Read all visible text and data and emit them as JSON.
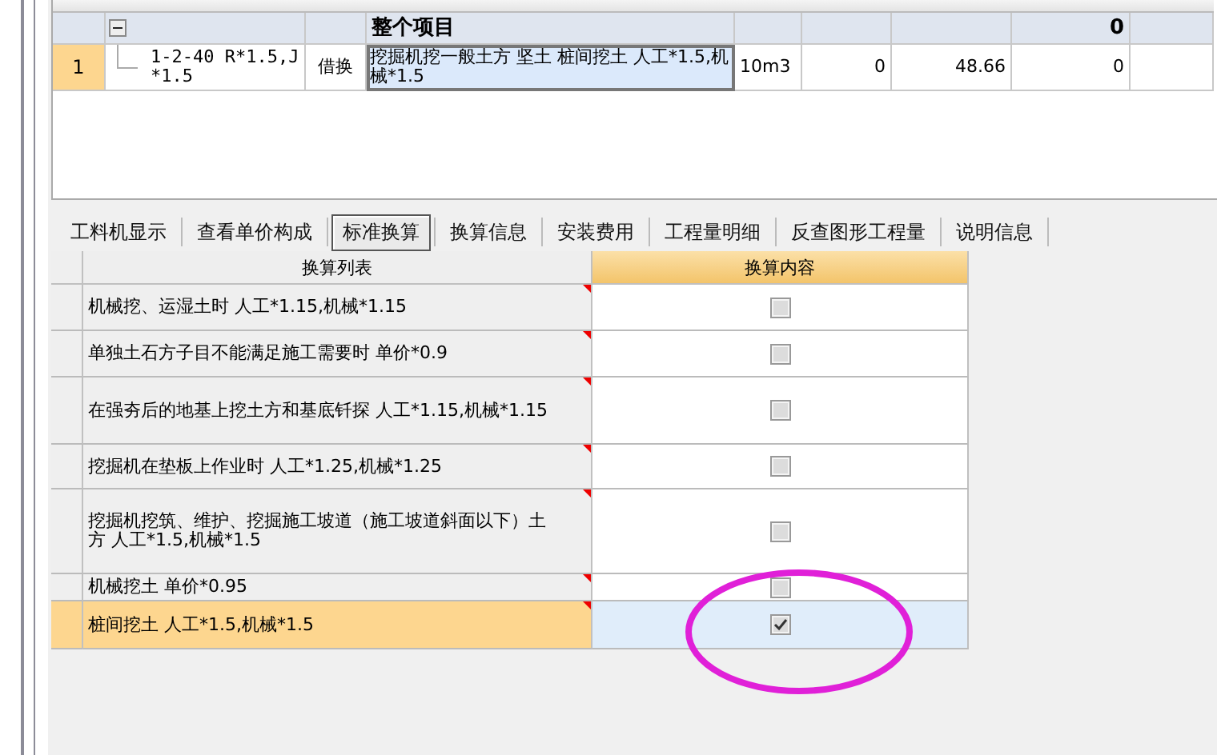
{
  "project_table": {
    "group_row": {
      "name": "整个项目",
      "total": "0",
      "expanded": true
    },
    "rows": [
      {
        "index": "1",
        "code": "1-2-40 R*1.5,J*1.5",
        "type": "借换",
        "name": "挖掘机挖一般土方 坚土 桩间挖土 人工*1.5,机械*1.5",
        "unit": "10m3",
        "quantity": "0",
        "unit_price": "48.66",
        "total": "0",
        "editing": true
      }
    ]
  },
  "tabs": [
    {
      "label": "工料机显示",
      "selected": false
    },
    {
      "label": "查看单价构成",
      "selected": false
    },
    {
      "label": "标准换算",
      "selected": true
    },
    {
      "label": "换算信息",
      "selected": false
    },
    {
      "label": "安装费用",
      "selected": false
    },
    {
      "label": "工程量明细",
      "selected": false
    },
    {
      "label": "反查图形工程量",
      "selected": false
    },
    {
      "label": "说明信息",
      "selected": false
    }
  ],
  "conversion_table": {
    "columns": [
      "换算列表",
      "换算内容"
    ],
    "rows": [
      {
        "text": "机械挖、运湿土时 人工*1.15,机械*1.15",
        "checked": false,
        "selected": false
      },
      {
        "text": "单独土石方子目不能满足施工需要时 单价*0.9",
        "checked": false,
        "selected": false
      },
      {
        "text": "在强夯后的地基上挖土方和基底钎探 人工*1.15,机械*1.15",
        "checked": false,
        "selected": false
      },
      {
        "text": "挖掘机在垫板上作业时 人工*1.25,机械*1.25",
        "checked": false,
        "selected": false
      },
      {
        "text": "挖掘机挖筑、维护、挖掘施工坡道（施工坡道斜面以下）土方 人工*1.5,机械*1.5",
        "checked": false,
        "selected": false
      },
      {
        "text": "机械挖土 单价*0.95",
        "checked": false,
        "selected": false
      },
      {
        "text": "桩间挖土 人工*1.5,机械*1.5",
        "checked": true,
        "selected": true
      }
    ]
  }
}
